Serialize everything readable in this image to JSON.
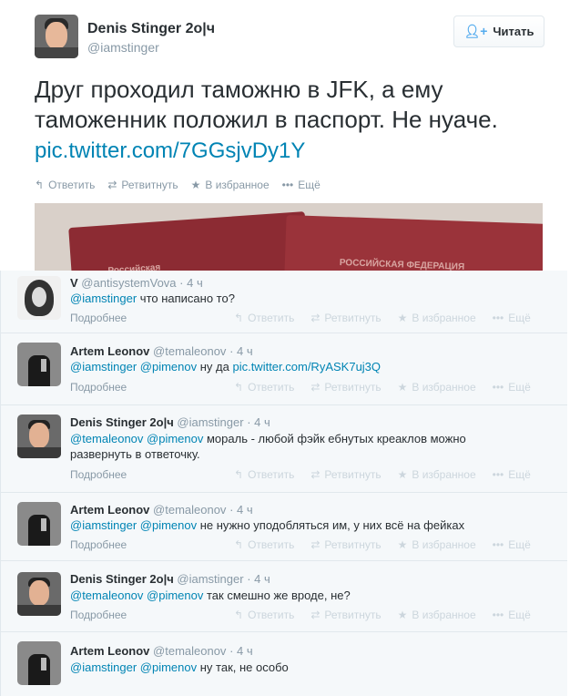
{
  "main": {
    "name": "Denis Stinger 2o|ч",
    "handle": "@iamstinger",
    "follow_label": "Читать",
    "follow_icon": "add-user-icon",
    "text": "Друг проходил таможню в JFK, а ему таможенник положил в паспорт. Не нуаче.",
    "link": "pic.twitter.com/7GGsjvDy1Y",
    "actions": {
      "reply": "Ответить",
      "retweet": "Ретвитнуть",
      "favorite": "В избранное",
      "more": "Ещё"
    },
    "media": {
      "text_left": "Российская",
      "text_right": "РОССИЙСКАЯ ФЕДЕРАЦИЯ"
    }
  },
  "replies": [
    {
      "name": "V",
      "handle": "@antisystemVova",
      "time": "· 4 ч",
      "mentions": "@iamstinger",
      "text": "что написано то?",
      "more": "Подробнее"
    },
    {
      "name": "Artem Leonov",
      "handle": "@temaleonov",
      "time": "· 4 ч",
      "mentions": "@iamstinger @pimenov",
      "text": "ну да",
      "link": "pic.twitter.com/RyASK7uj3Q",
      "more": "Подробнее"
    },
    {
      "name": "Denis Stinger 2o|ч",
      "handle": "@iamstinger",
      "time": "· 4 ч",
      "mentions": "@temaleonov @pimenov",
      "text": "мораль - любой фэйк ебнутых креаклов можно",
      "text2": "развернуть в ответочку.",
      "more": "Подробнее"
    },
    {
      "name": "Artem Leonov",
      "handle": "@temaleonov",
      "time": "· 4 ч",
      "mentions": "@iamstinger @pimenov",
      "text": "не нужно уподобляться им, у них всё на фейках",
      "more": "Подробнее"
    },
    {
      "name": "Denis Stinger 2o|ч",
      "handle": "@iamstinger",
      "time": "· 4 ч",
      "mentions": "@temaleonov @pimenov",
      "text": "так смешно же вроде, не?",
      "more": "Подробнее"
    },
    {
      "name": "Artem Leonov",
      "handle": "@temaleonov",
      "time": "· 4 ч",
      "mentions": "@iamstinger @pimenov",
      "text": "ну так, не особо"
    }
  ]
}
